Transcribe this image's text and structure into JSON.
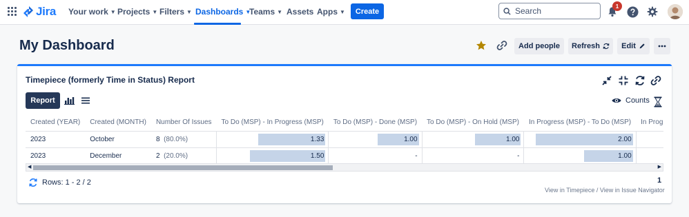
{
  "nav": {
    "logo": "Jira",
    "items": [
      {
        "label": "Your work"
      },
      {
        "label": "Projects"
      },
      {
        "label": "Filters"
      },
      {
        "label": "Dashboards"
      },
      {
        "label": "Teams"
      },
      {
        "label": "Assets"
      },
      {
        "label": "Apps"
      }
    ],
    "create": "Create",
    "search_placeholder": "Search",
    "notification_count": "1"
  },
  "dashboard": {
    "title": "My Dashboard",
    "buttons": {
      "add_people": "Add people",
      "refresh": "Refresh",
      "edit": "Edit"
    }
  },
  "gadget": {
    "title": "Timepiece (formerly Time in Status) Report",
    "view_report": "Report",
    "counts_label": "Counts",
    "columns": [
      "Created (YEAR)",
      "Created (MONTH)",
      "Number Of Issues",
      "To Do (MSP) - In Progress (MSP)",
      "To Do (MSP) - Done (MSP)",
      "To Do (MSP) - On Hold (MSP)",
      "In Progress (MSP) - To Do (MSP)",
      "In Progre"
    ],
    "rows": [
      {
        "year": "2023",
        "month": "October",
        "count": "8",
        "pct": "(80.0%)",
        "c1": "1.33",
        "c2": "1.00",
        "c3": "1.00",
        "c4": "2.00",
        "c5": ""
      },
      {
        "year": "2023",
        "month": "December",
        "count": "2",
        "pct": "(20.0%)",
        "c1": "1.50",
        "c2": "-",
        "c3": "-",
        "c4": "1.00",
        "c5": ""
      }
    ],
    "rows_info": "Rows: 1 - 2 / 2",
    "page": "1",
    "link_timepiece": "View in Timepiece",
    "link_sep": "/",
    "link_navigator": "View in Issue Navigator"
  }
}
